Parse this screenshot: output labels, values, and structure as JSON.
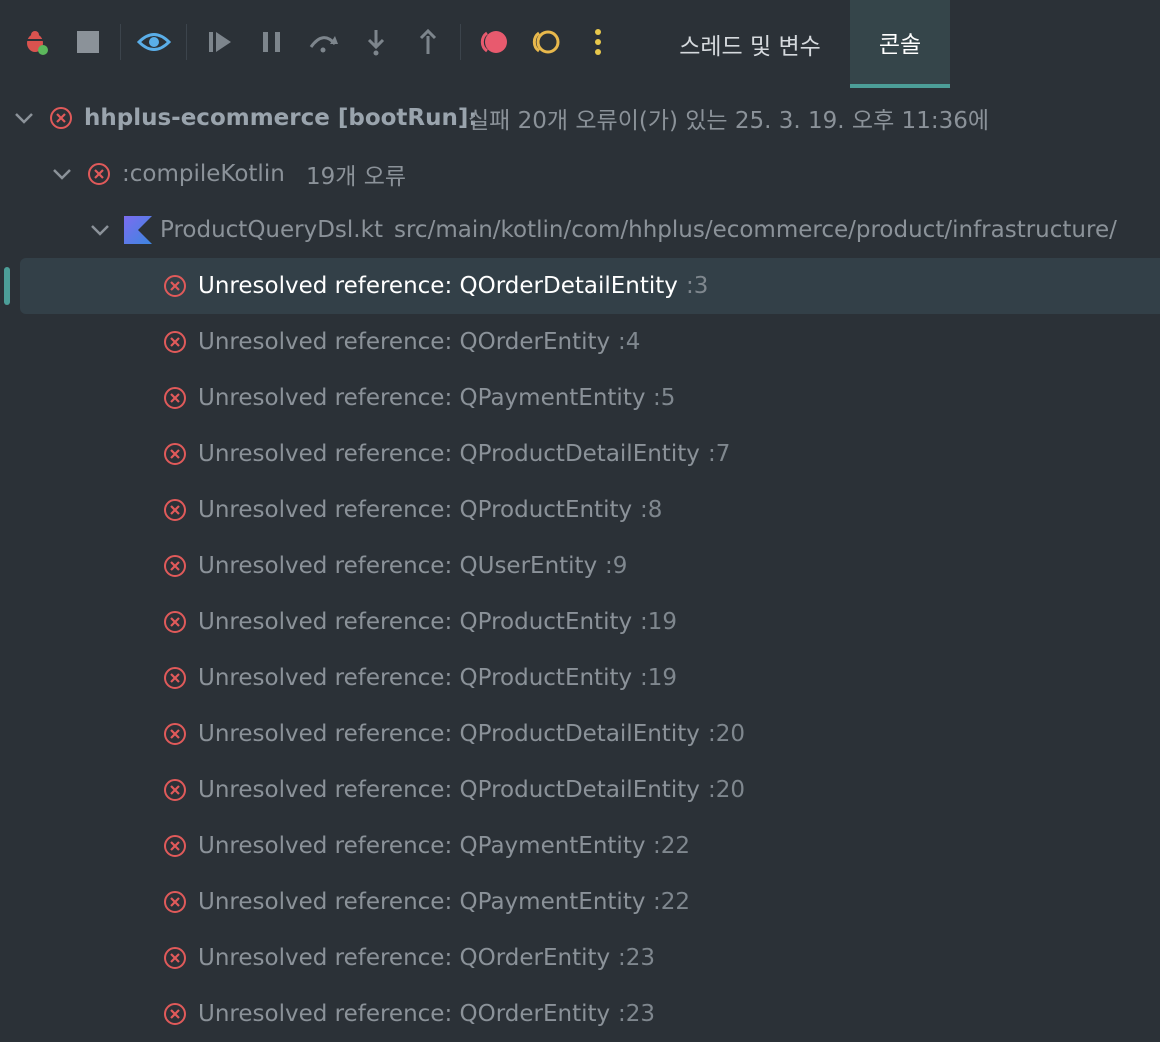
{
  "toolbar": {
    "icons": [
      "debug-bug-icon",
      "stop-icon",
      "watch-eye-icon",
      "resume-icon",
      "pause-icon",
      "step-over-icon",
      "step-into-icon",
      "step-out-icon",
      "record-icon",
      "rerun-icon",
      "more-vertical-icon"
    ],
    "tabs": [
      {
        "label": "스레드 및 변수",
        "active": false
      },
      {
        "label": "콘솔",
        "active": true
      }
    ]
  },
  "tree": {
    "root": {
      "title": "hhplus-ecommerce [bootRun]:",
      "status": "실패 20개 오류이(가) 있는 25. 3. 19. 오후 11:36에"
    },
    "task": {
      "name": ":compileKotlin",
      "count": "19개 오류"
    },
    "file": {
      "name": "ProductQueryDsl.kt",
      "path": "src/main/kotlin/com/hhplus/ecommerce/product/infrastructure/"
    },
    "errors": [
      {
        "message": "Unresolved reference: QOrderDetailEntity",
        "line": ":3",
        "selected": true
      },
      {
        "message": "Unresolved reference: QOrderEntity",
        "line": ":4"
      },
      {
        "message": "Unresolved reference: QPaymentEntity",
        "line": ":5"
      },
      {
        "message": "Unresolved reference: QProductDetailEntity",
        "line": ":7"
      },
      {
        "message": "Unresolved reference: QProductEntity",
        "line": ":8"
      },
      {
        "message": "Unresolved reference: QUserEntity",
        "line": ":9"
      },
      {
        "message": "Unresolved reference: QProductEntity",
        "line": ":19"
      },
      {
        "message": "Unresolved reference: QProductEntity",
        "line": ":19"
      },
      {
        "message": "Unresolved reference: QProductDetailEntity",
        "line": ":20"
      },
      {
        "message": "Unresolved reference: QProductDetailEntity",
        "line": ":20"
      },
      {
        "message": "Unresolved reference: QPaymentEntity",
        "line": ":22"
      },
      {
        "message": "Unresolved reference: QPaymentEntity",
        "line": ":22"
      },
      {
        "message": "Unresolved reference: QOrderEntity",
        "line": ":23"
      },
      {
        "message": "Unresolved reference: QOrderEntity",
        "line": ":23"
      }
    ]
  },
  "colors": {
    "error": "#e05a5a",
    "accent": "#4c9e98",
    "bg": "#2b3137"
  }
}
